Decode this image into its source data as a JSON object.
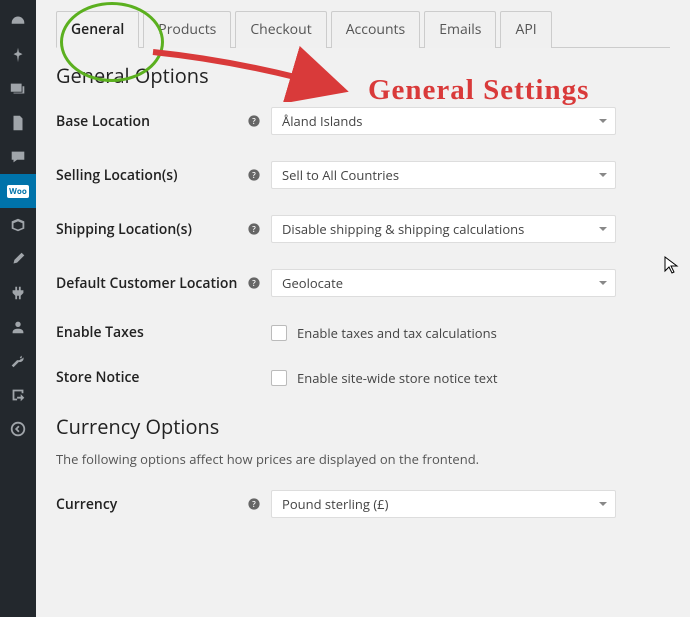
{
  "sidebar": {
    "items": [
      {
        "name": "dashboard"
      },
      {
        "name": "pin"
      },
      {
        "name": "media"
      },
      {
        "name": "pages"
      },
      {
        "name": "comments"
      },
      {
        "name": "woocommerce",
        "active": true,
        "label": "Woo"
      },
      {
        "name": "products"
      },
      {
        "name": "appearance"
      },
      {
        "name": "plugins"
      },
      {
        "name": "users"
      },
      {
        "name": "tools"
      },
      {
        "name": "settings-import"
      },
      {
        "name": "collapse"
      }
    ]
  },
  "tabs": [
    {
      "label": "General",
      "active": true
    },
    {
      "label": "Products"
    },
    {
      "label": "Checkout"
    },
    {
      "label": "Accounts"
    },
    {
      "label": "Emails"
    },
    {
      "label": "API"
    }
  ],
  "section_general": "General Options",
  "fields": {
    "base_location": {
      "label": "Base Location",
      "value": "Åland Islands"
    },
    "selling_locations": {
      "label": "Selling Location(s)",
      "value": "Sell to All Countries"
    },
    "shipping_locations": {
      "label": "Shipping Location(s)",
      "value": "Disable shipping & shipping calculations"
    },
    "default_customer_location": {
      "label": "Default Customer Location",
      "value": "Geolocate"
    },
    "enable_taxes": {
      "label": "Enable Taxes",
      "check_label": "Enable taxes and tax calculations"
    },
    "store_notice": {
      "label": "Store Notice",
      "check_label": "Enable site-wide store notice text"
    }
  },
  "section_currency": "Currency Options",
  "currency_desc": "The following options affect how prices are displayed on the frontend.",
  "currency": {
    "label": "Currency",
    "value": "Pound sterling (£)"
  },
  "annotation": {
    "label": "General Settings",
    "color": "#d93a3a"
  }
}
